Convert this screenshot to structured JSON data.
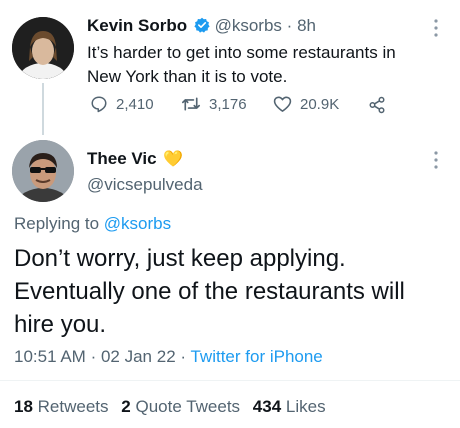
{
  "parent_tweet": {
    "author_name": "Kevin Sorbo",
    "handle": "@ksorbs",
    "separator": "·",
    "time": "8h",
    "text_line1": "It’s harder to get into some restaurants in",
    "text_line2": "New York than it is to vote.",
    "replies": "2,410",
    "retweets": "3,176",
    "likes": "20.9K"
  },
  "reply_tweet": {
    "author_name": "Thee Vic",
    "emoji": "💛",
    "handle": "@vicsepulveda",
    "replying_to_prefix": "Replying to ",
    "replying_to_handle": "@ksorbs",
    "text_line1": "Don’t worry, just keep applying.",
    "text_line2": "Eventually one of the restaurants will",
    "text_line3": "hire you.",
    "time": "10:51 AM",
    "dot1": "·",
    "date": "02 Jan 22",
    "dot2": "·",
    "source": "Twitter for iPhone",
    "retweets_count": "18",
    "retweets_label": "Retweets",
    "quote_count": "2",
    "quote_label": "Quote Tweets",
    "likes_count": "434",
    "likes_label": "Likes"
  },
  "colors": {
    "accent": "#1d9bf0",
    "muted": "#536471",
    "heart_emoji": "#f7c844"
  },
  "icons": [
    "verified-badge-icon",
    "more-options-icon",
    "reply-icon",
    "retweet-icon",
    "like-icon",
    "share-icon"
  ]
}
